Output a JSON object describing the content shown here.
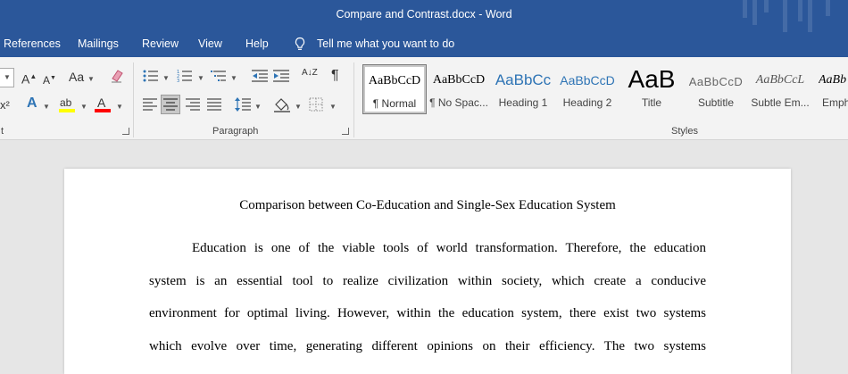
{
  "window": {
    "title": "Compare and Contrast.docx  -  Word"
  },
  "menu": {
    "tabs": [
      "References",
      "Mailings",
      "Review",
      "View",
      "Help"
    ],
    "tell_me": "Tell me what you want to do"
  },
  "ribbon": {
    "font_group_label": "t",
    "paragraph_group_label": "Paragraph",
    "styles_group_label": "Styles",
    "font": {
      "grow": "A",
      "shrink": "A",
      "change_case": "Aa",
      "superscript": "x²",
      "text_effects": "A",
      "highlight": "ab",
      "font_color": "A"
    },
    "paragraph": {
      "sort": "A↓Z",
      "pilcrow": "¶"
    },
    "styles": [
      {
        "sample": "AaBbCcD",
        "name": "¶ Normal"
      },
      {
        "sample": "AaBbCcD",
        "name": "¶ No Spac..."
      },
      {
        "sample": "AaBbCc",
        "name": "Heading 1"
      },
      {
        "sample": "AaBbCcD",
        "name": "Heading 2"
      },
      {
        "sample": "AaB",
        "name": "Title"
      },
      {
        "sample": "AaBbCcD",
        "name": "Subtitle"
      },
      {
        "sample": "AaBbCcL",
        "name": "Subtle Em..."
      },
      {
        "sample": "AaBb",
        "name": "Emph"
      }
    ]
  },
  "colors": {
    "titlebar": "#2b579a",
    "heading_blue": "#2e74b5",
    "highlight_yellow": "#ffff00",
    "font_color_red": "#ff0000"
  },
  "document": {
    "title": "Comparison between Co-Education and Single-Sex Education System",
    "lines": [
      "Education is one of the viable tools of world transformation. Therefore, the education",
      "system is an essential tool to realize civilization within society, which create a conducive",
      "environment for optimal living. However, within the education system, there exist two systems",
      "which evolve over time, generating different opinions on their efficiency. The two systems"
    ]
  }
}
